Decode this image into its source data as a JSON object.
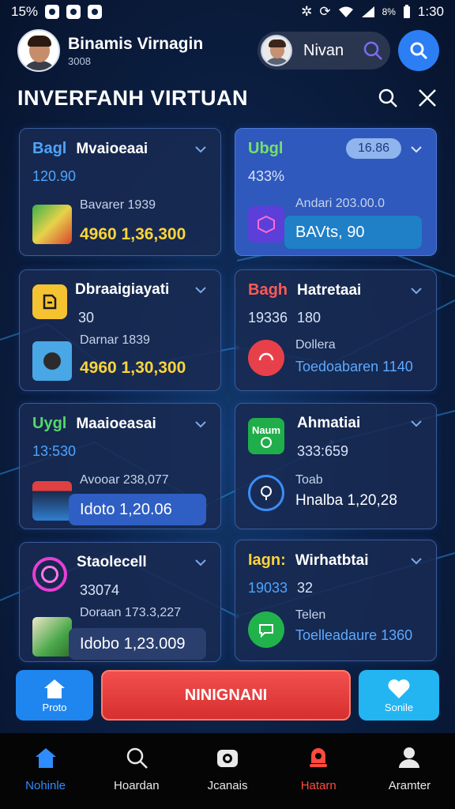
{
  "status_bar": {
    "battery_percent": "15%",
    "time": "1:30",
    "signal_text": "8%"
  },
  "header": {
    "user_name": "Binamis Virnagin",
    "user_sub": "3008",
    "profile_name": "Nivan"
  },
  "title": "INVERFANH VIRTUAN",
  "cards": [
    {
      "tag": "Bagl",
      "title": "Mvaioeaai",
      "value": "120.90",
      "sub": "Bavarer 1939",
      "amount": "4960  1,36,300"
    },
    {
      "tag": "Ubgl",
      "title": "",
      "chip": "16.86",
      "value": "433%",
      "sub": "Andari 203.00.0",
      "amount": "BAVts, 90"
    },
    {
      "tag": "",
      "title": "Dbraaigiayati",
      "value": "30",
      "sub": "Darnar 1839",
      "amount": "4960  1,30,300"
    },
    {
      "tag": "Bagh",
      "title": "Hatretaai",
      "value": "19336",
      "value2": "180",
      "sub": "Dollera",
      "amount": "Toedoabaren 1140"
    },
    {
      "tag": "Uygl",
      "title": "Maaioeasai",
      "value": "13:530",
      "sub": "Avooar 238,077",
      "amount": "Idoto 1,20.06"
    },
    {
      "tag": "Naum",
      "title": "Ahmatiai",
      "value": "333:659",
      "sub": "Toab",
      "amount": "Hnalba 1,20,28"
    },
    {
      "tag": "",
      "title": "Staolecell",
      "value": "33074",
      "sub": "Doraan 173.3,227",
      "amount": "Idobo 1,23.009"
    },
    {
      "tag": "Iagn:",
      "title": "Wirhatbtai",
      "value": "19033",
      "value2": "32",
      "sub": "Telen",
      "amount": "Toelleadaure 1360"
    }
  ],
  "actions": {
    "left_label": "Proto",
    "main_label": "NINIGNANI",
    "right_label": "Sonile"
  },
  "nav": [
    {
      "label": "Nohinle",
      "icon": "home-icon",
      "color": "#2f8cff"
    },
    {
      "label": "Hoardan",
      "icon": "search-icon",
      "color": "#e9e9e9"
    },
    {
      "label": "Jcanais",
      "icon": "camera-icon",
      "color": "#e9e9e9"
    },
    {
      "label": "Hatarn",
      "icon": "alert-icon",
      "color": "#ff4a3d"
    },
    {
      "label": "Aramter",
      "icon": "profile-icon",
      "color": "#e9e9e9"
    }
  ],
  "colors": {
    "accent": "#2b7ef3",
    "danger": "#e23c3c",
    "gold": "#ffd43a",
    "cyan": "#22b5f2"
  }
}
